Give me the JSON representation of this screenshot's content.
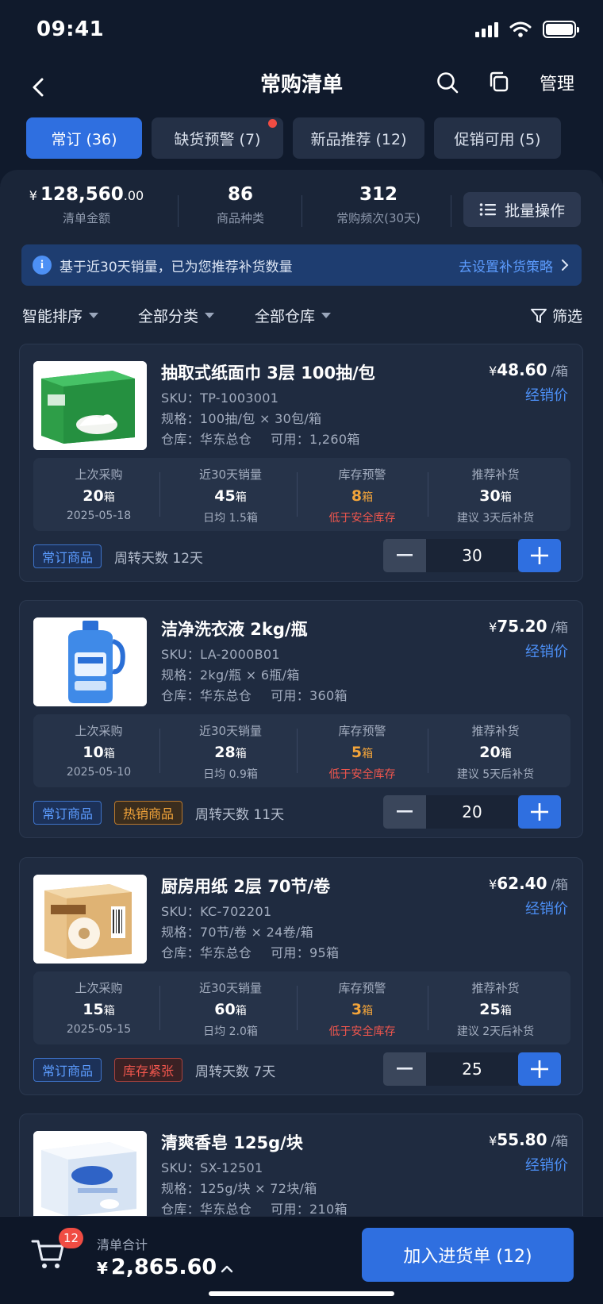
{
  "status": {
    "time": "09:41"
  },
  "nav": {
    "title": "常购清单",
    "manage": "管理"
  },
  "tabs": [
    {
      "label": "常订 (36)",
      "active": true
    },
    {
      "label": "缺货预警 (7)",
      "dot": true
    },
    {
      "label": "新品推荐 (12)"
    },
    {
      "label": "促销可用 (5)"
    }
  ],
  "summary": {
    "amount_currency": "¥",
    "amount_int": "128,560",
    "amount_dec": ".00",
    "amount_label": "清单金额",
    "sku_count": "86",
    "sku_label": "商品种类",
    "freq": "312",
    "freq_label": "常购频次(30天)",
    "batch_label": "批量操作"
  },
  "banner": {
    "text": "基于近30天销量，已为您推荐补货数量",
    "link": "去设置补货策略"
  },
  "filters": {
    "sort": "智能排序",
    "category": "全部分类",
    "warehouse": "全部仓库",
    "filter": "筛选"
  },
  "stat_labels": {
    "last": "上次采购",
    "sales": "近30天销量",
    "warn": "库存预警",
    "rec": "推荐补货"
  },
  "products": [
    {
      "name": "抽取式纸面巾 3层 100抽/包",
      "sku": "SKU：TP-1003001",
      "spec": "规格：100抽/包 × 30包/箱",
      "warehouse": "仓库：华东总仓",
      "available": "可用：1,260箱",
      "price_yen": "¥",
      "price": "48.60",
      "price_unit": " /箱",
      "price_tag": "经销价",
      "last_qty": "20",
      "unit": "箱",
      "last_date": "2025-05-18",
      "sales_qty": "45",
      "sales_avg": "日均 1.5箱",
      "warn_qty": "8",
      "warn_text": "低于安全库存",
      "rec_qty": "30",
      "rec_text": "建议 3天后补货",
      "tag1": "常订商品",
      "tag2": "",
      "turnover": "周转天数 12天",
      "qty": "30",
      "image": "tissue-box"
    },
    {
      "name": "洁净洗衣液 2kg/瓶",
      "sku": "SKU：LA-2000B01",
      "spec": "规格：2kg/瓶 × 6瓶/箱",
      "warehouse": "仓库：华东总仓",
      "available": "可用：360箱",
      "price_yen": "¥",
      "price": "75.20",
      "price_unit": " /箱",
      "price_tag": "经销价",
      "last_qty": "10",
      "unit": "箱",
      "last_date": "2025-05-10",
      "sales_qty": "28",
      "sales_avg": "日均 0.9箱",
      "warn_qty": "5",
      "warn_text": "低于安全库存",
      "rec_qty": "20",
      "rec_text": "建议 5天后补货",
      "tag1": "常订商品",
      "tag2": "热销商品",
      "turnover": "周转天数 11天",
      "qty": "20",
      "image": "detergent-bottle"
    },
    {
      "name": "厨房用纸 2层 70节/卷",
      "sku": "SKU：KC-702201",
      "spec": "规格：70节/卷 × 24卷/箱",
      "warehouse": "仓库：华东总仓",
      "available": "可用：95箱",
      "price_yen": "¥",
      "price": "62.40",
      "price_unit": " /箱",
      "price_tag": "经销价",
      "last_qty": "15",
      "unit": "箱",
      "last_date": "2025-05-15",
      "sales_qty": "60",
      "sales_avg": "日均 2.0箱",
      "warn_qty": "3",
      "warn_text": "低于安全库存",
      "rec_qty": "25",
      "rec_text": "建议 2天后补货",
      "tag1": "常订商品",
      "tag2": "库存紧张",
      "turnover": "周转天数 7天",
      "qty": "25",
      "image": "kitchen-roll"
    },
    {
      "name": "清爽香皂 125g/块",
      "sku": "SKU：SX-12501",
      "spec": "规格：125g/块 × 72块/箱",
      "warehouse": "仓库：华东总仓",
      "available": "可用：210箱",
      "price_yen": "¥",
      "price": "55.80",
      "price_unit": " /箱",
      "price_tag": "经销价",
      "image": "soap-box"
    }
  ],
  "footer": {
    "cart_count": "12",
    "total_label": "清单合计",
    "total_yen": "¥",
    "total": "2,865.60",
    "cta": "加入进货单 (12)"
  },
  "colors": {
    "accent": "#2f6fe0",
    "warn": "#f2a43a",
    "danger": "#f0564d",
    "link": "#4c8ff5"
  }
}
